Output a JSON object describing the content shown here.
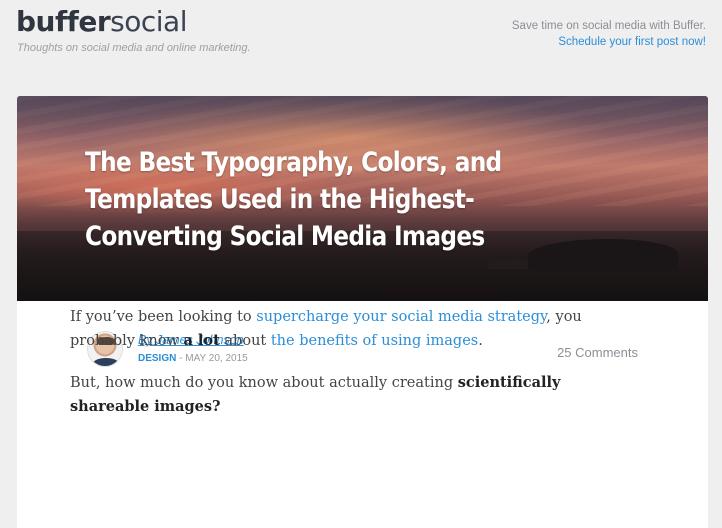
{
  "header": {
    "logo_bold": "buffer",
    "logo_light": "social",
    "tagline": "Thoughts on social media and online marketing.",
    "promo_text": "Save time on social media with Buffer.",
    "promo_link": "Schedule your first post now!"
  },
  "article": {
    "title": "The Best Typography, Colors, and Templates Used in the Highest-Converting Social Media Images",
    "author": "By James Johnson",
    "category": "DESIGN",
    "date_sep": " - ",
    "date": "MAY 20, 2015",
    "comments": "25 Comments",
    "p1_a": "If you’ve been looking to ",
    "p1_link1": "supercharge your social media strategy",
    "p1_b": ", you probably know ",
    "p1_bold": "a lot",
    "p1_c": " about ",
    "p1_link2": "the benefits of using images",
    "p1_d": ".",
    "p2_a": "But, how much do you know about actually creating ",
    "p2_bold": "scientifically shareable images?"
  },
  "colors": {
    "link": "#2a8ed8",
    "background": "#efefef",
    "card": "#ffffff"
  }
}
